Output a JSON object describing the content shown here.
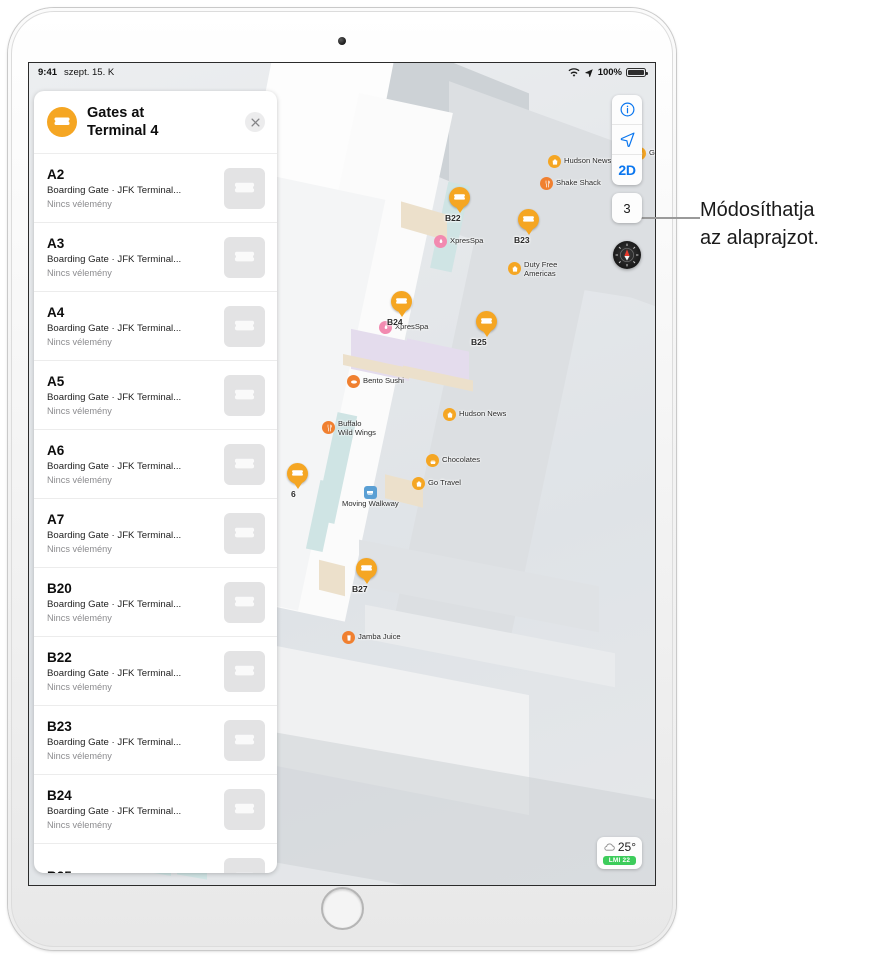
{
  "statusbar": {
    "time": "9:41",
    "date": "szept. 15. K",
    "battery_pct": "100%",
    "wifi_icon": "wifi-icon",
    "location_icon": "location-arrow-icon",
    "battery_icon": "battery-icon"
  },
  "panel": {
    "title": "Gates at\nTerminal 4",
    "title_line1": "Gates at",
    "title_line2": "Terminal 4",
    "header_icon": "boarding-pass-icon",
    "close_icon": "close-icon",
    "subtitle_text": "Boarding Gate · JFK Terminal...",
    "reviews_text": "Nincs vélemény",
    "items": [
      {
        "name": "A2",
        "subtitle": "Boarding Gate · JFK Terminal...",
        "reviews": "Nincs vélemény"
      },
      {
        "name": "A3",
        "subtitle": "Boarding Gate · JFK Terminal...",
        "reviews": "Nincs vélemény"
      },
      {
        "name": "A4",
        "subtitle": "Boarding Gate · JFK Terminal...",
        "reviews": "Nincs vélemény"
      },
      {
        "name": "A5",
        "subtitle": "Boarding Gate · JFK Terminal...",
        "reviews": "Nincs vélemény"
      },
      {
        "name": "A6",
        "subtitle": "Boarding Gate · JFK Terminal...",
        "reviews": "Nincs vélemény"
      },
      {
        "name": "A7",
        "subtitle": "Boarding Gate · JFK Terminal...",
        "reviews": "Nincs vélemény"
      },
      {
        "name": "B20",
        "subtitle": "Boarding Gate · JFK Terminal...",
        "reviews": "Nincs vélemény"
      },
      {
        "name": "B22",
        "subtitle": "Boarding Gate · JFK Terminal...",
        "reviews": "Nincs vélemény"
      },
      {
        "name": "B23",
        "subtitle": "Boarding Gate · JFK Terminal...",
        "reviews": "Nincs vélemény"
      },
      {
        "name": "B24",
        "subtitle": "Boarding Gate · JFK Terminal...",
        "reviews": "Nincs vélemény"
      }
    ]
  },
  "map_controls": {
    "info_icon": "info-circle-icon",
    "locate_icon": "location-arrow-icon",
    "dimension_label": "2D",
    "floor_label": "3",
    "compass_icon": "compass-icon"
  },
  "weather": {
    "temperature": "25°",
    "condition_icon": "cloud-icon",
    "aqi_label": "LMI 22",
    "aqi_color": "#3dcc5b"
  },
  "map_pins": [
    {
      "label": "B22",
      "icon": "boarding-pass-icon"
    },
    {
      "label": "B23",
      "icon": "boarding-pass-icon"
    },
    {
      "label": "B24",
      "icon": "boarding-pass-icon"
    },
    {
      "label": "B25",
      "icon": "boarding-pass-icon"
    },
    {
      "label": "B27",
      "icon": "boarding-pass-icon"
    }
  ],
  "map_pois": [
    {
      "label": "Hudson News",
      "icon": "shopping-bag-icon",
      "color": "#f5a623"
    },
    {
      "label": "Shake Shack",
      "icon": "restaurant-icon",
      "color": "#f08030"
    },
    {
      "label": "XpresSpa",
      "icon": "spa-icon",
      "color": "#f28ab0"
    },
    {
      "label": "Duty Free\nAmericas",
      "icon": "shopping-bag-icon",
      "color": "#f5a623"
    },
    {
      "label": "XpresSpa",
      "icon": "spa-icon",
      "color": "#f28ab0"
    },
    {
      "label": "Bento Sushi",
      "icon": "cafe-icon",
      "color": "#f08030"
    },
    {
      "label": "Buffalo\nWild Wings",
      "icon": "restaurant-icon",
      "color": "#f08030"
    },
    {
      "label": "Hudson News",
      "icon": "shopping-bag-icon",
      "color": "#f5a623"
    },
    {
      "label": "Chocolates",
      "icon": "dessert-icon",
      "color": "#f5a623"
    },
    {
      "label": "Go Travel",
      "icon": "shopping-bag-icon",
      "color": "#f5a623"
    },
    {
      "label": "Moving Walkway",
      "icon": "walkway-icon",
      "color": "#5a9fd4"
    },
    {
      "label": "Jamba Juice",
      "icon": "juice-icon",
      "color": "#f08030"
    }
  ],
  "callout": {
    "line1": "Módosíthatja",
    "line2": "az alaprajzot."
  },
  "colors": {
    "accent_orange": "#f5a623",
    "accent_blue": "#0a76ef",
    "aqi_green": "#3dcc5b"
  }
}
